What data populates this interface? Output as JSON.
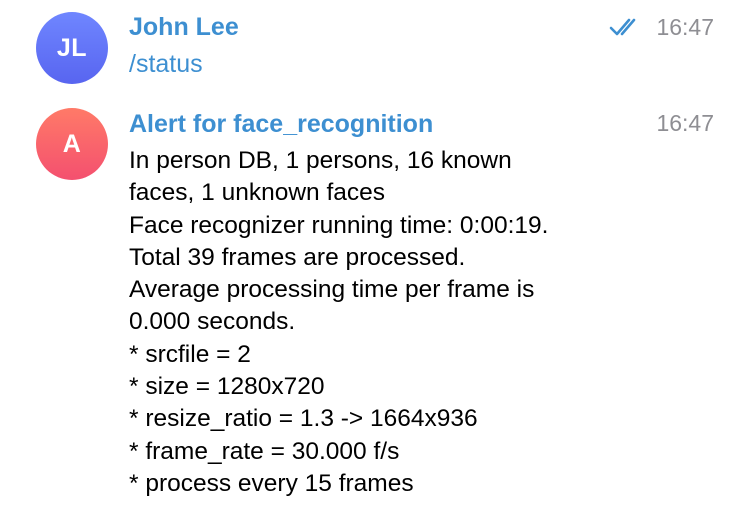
{
  "messages": [
    {
      "avatar_initials": "JL",
      "sender": "John Lee",
      "text": "/status",
      "time": "16:47",
      "status_icon": "double-check-icon",
      "avatar_color": "#5b6cf5"
    },
    {
      "avatar_initials": "A",
      "sender": "Alert for face_recognition",
      "time": "16:47",
      "avatar_color": "#f5586b",
      "lines": [
        "In person DB, 1 persons, 16 known",
        "faces, 1 unknown faces",
        "Face recognizer running time: 0:00:19.",
        "Total 39 frames are processed.",
        "Average processing time per frame is",
        "0.000 seconds.",
        "* srcfile = 2",
        "* size = 1280x720",
        "* resize_ratio = 1.3 -> 1664x936",
        "* frame_rate = 30.000 f/s",
        "* process every 15 frames"
      ]
    }
  ],
  "colors": {
    "sender": "#3d8fd1",
    "time": "#8e8e93",
    "ticks": "#3d8fd1"
  }
}
